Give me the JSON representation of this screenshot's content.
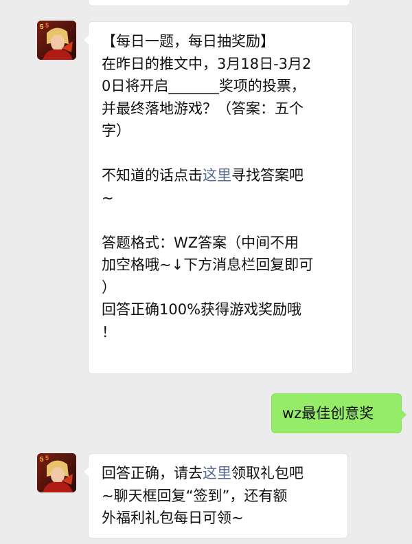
{
  "messages": [
    {
      "sender": "official",
      "avatar_icon": "game-hero-avatar-icon",
      "lines": {
        "l1": "【每日一题，每日抽奖励】",
        "l2": "在昨日的推文中，3月18日-3月2",
        "l3": "0日将开启_______奖项的投票，",
        "l4": "并最终落地游戏？（答案：五个",
        "l5": "字）",
        "l6_pre": "不知道的话点击",
        "l6_link": "这里",
        "l6_post": "寻找答案吧",
        "l7": "~",
        "l8": "答题格式：WZ答案（中间不用",
        "l9": "加空格哦~↓下方消息栏回复即可",
        "l10": "）",
        "l11": "回答正确100%获得游戏奖励哦",
        "l12": "！"
      }
    },
    {
      "sender": "me",
      "text": "wz最佳创意奖"
    },
    {
      "sender": "official",
      "avatar_icon": "game-hero-avatar-icon",
      "lines": {
        "l1_pre": "回答正确，请去",
        "l1_link": "这里",
        "l1_post": "领取礼包吧",
        "l2": "~聊天框回复“签到”，还有额",
        "l3": "外福利礼包每日可领~"
      }
    }
  ],
  "colors": {
    "background": "#ececec",
    "bubble_incoming": "#ffffff",
    "bubble_outgoing": "#95ec69",
    "link": "#576b95"
  }
}
